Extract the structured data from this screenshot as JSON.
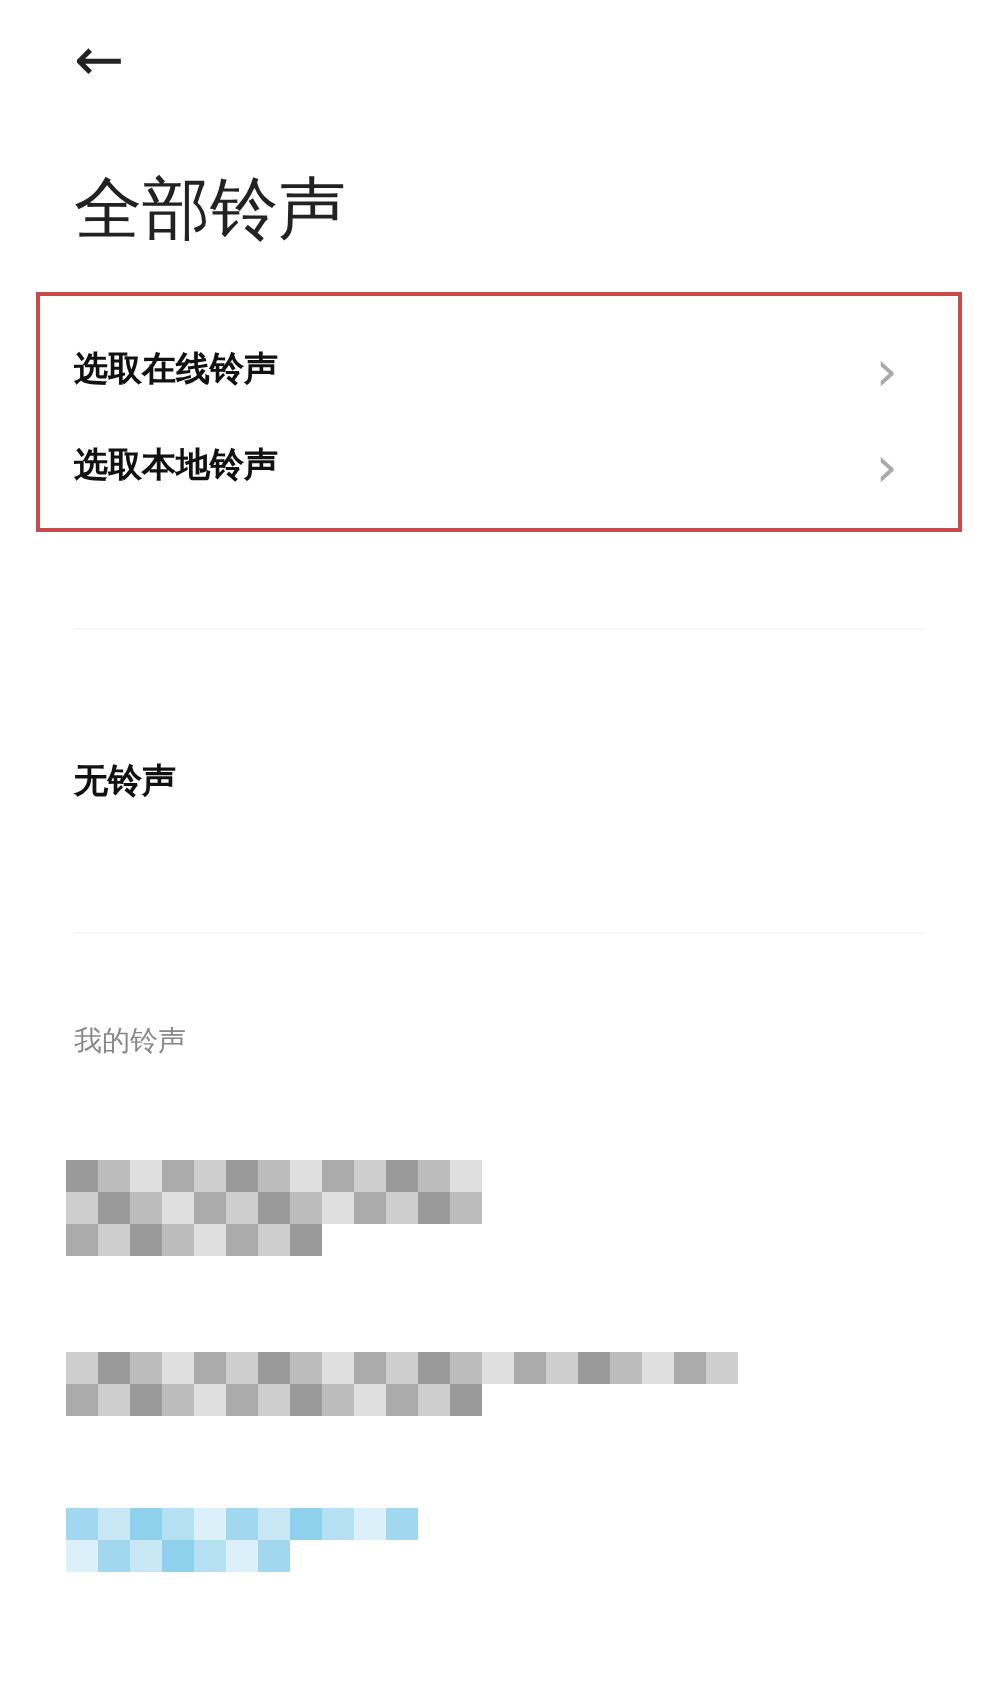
{
  "back_button": {
    "label": "←"
  },
  "title": "全部铃声",
  "highlighted_options": [
    {
      "label": "选取在线铃声",
      "chevron": "›"
    },
    {
      "label": "选取本地铃声",
      "chevron": "›"
    }
  ],
  "no_ringtone": {
    "label": "无铃声"
  },
  "my_ringtones": {
    "heading": "我的铃声",
    "items": [
      {
        "kind": "pixelated",
        "color": "#9a9a9a"
      },
      {
        "kind": "pixelated",
        "color": "#9a9a9a"
      },
      {
        "kind": "pixelated",
        "color": "#8fd0ec"
      }
    ]
  }
}
